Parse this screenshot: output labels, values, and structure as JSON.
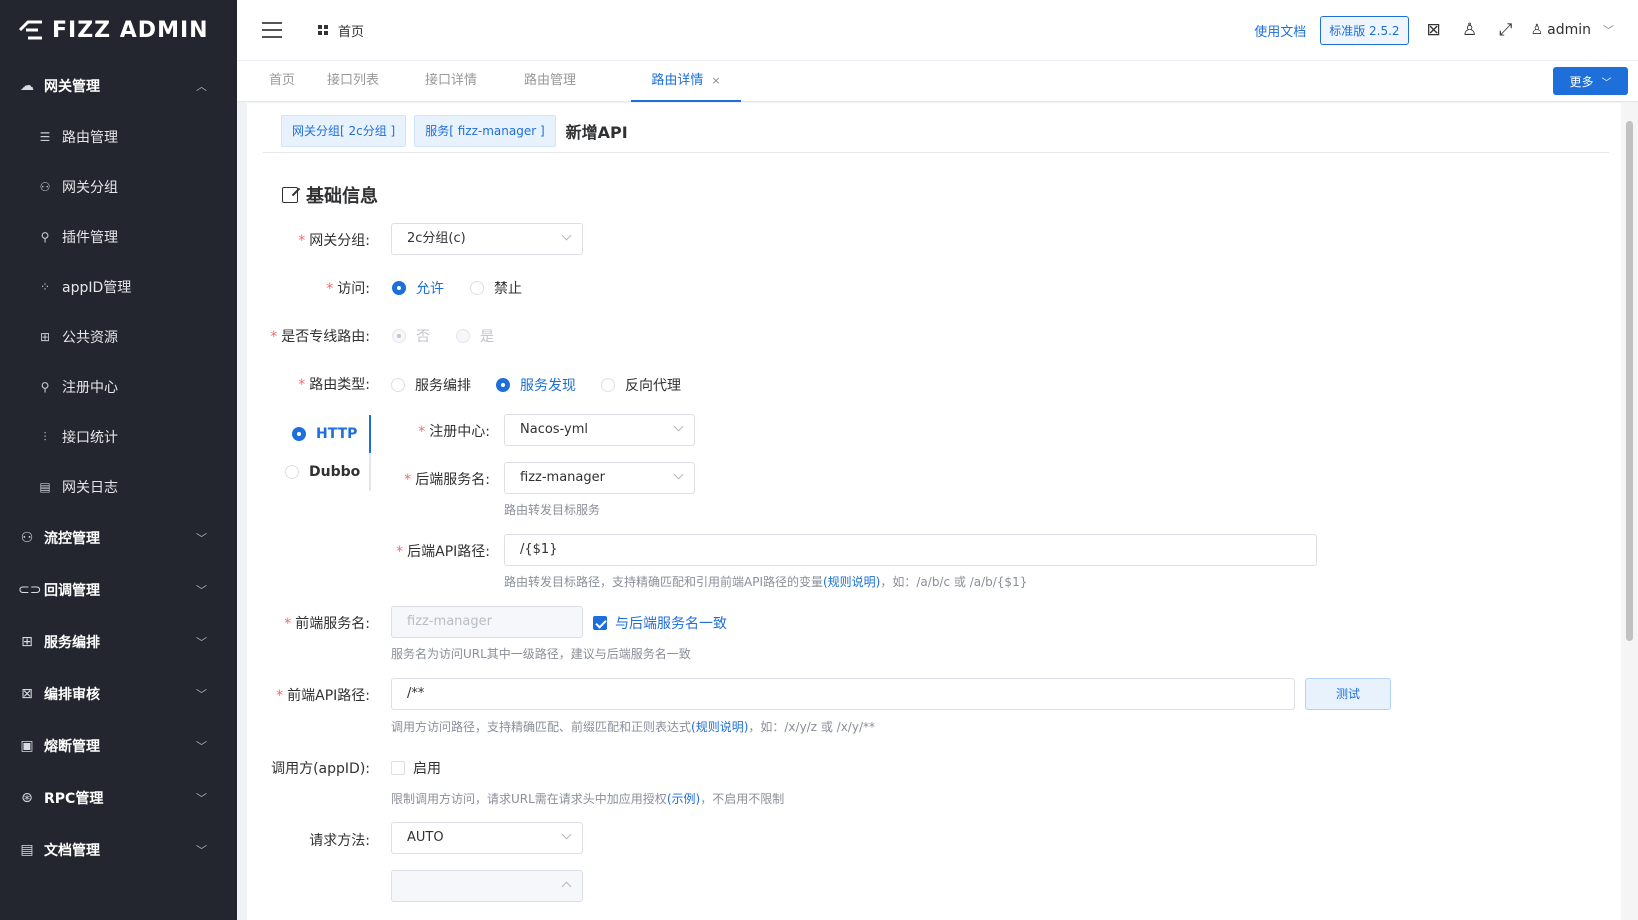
{
  "app": {
    "logo_text": "FIZZ ADMIN"
  },
  "sidebar": {
    "gateway_group": {
      "label": "网关管理"
    },
    "sub_items": [
      {
        "label": "路由管理",
        "icon": "list-icon"
      },
      {
        "label": "网关分组",
        "icon": "hierarchy-icon"
      },
      {
        "label": "插件管理",
        "icon": "pin-icon"
      },
      {
        "label": "appID管理",
        "icon": "grid-icon"
      },
      {
        "label": "公共资源",
        "icon": "table-icon"
      },
      {
        "label": "注册中心",
        "icon": "pin-icon"
      },
      {
        "label": "接口统计",
        "icon": "chart-icon"
      },
      {
        "label": "网关日志",
        "icon": "log-icon"
      }
    ],
    "groups": [
      {
        "label": "流控管理"
      },
      {
        "label": "回调管理"
      },
      {
        "label": "服务编排"
      },
      {
        "label": "编排审核"
      },
      {
        "label": "熔断管理"
      },
      {
        "label": "RPC管理"
      },
      {
        "label": "文档管理"
      }
    ]
  },
  "header": {
    "home": "首页",
    "doc_link": "使用文档",
    "version": "标准版 2.5.2",
    "user": "admin"
  },
  "tabs": [
    {
      "label": "首页"
    },
    {
      "label": "接口列表"
    },
    {
      "label": "接口详情"
    },
    {
      "label": "路由管理"
    },
    {
      "label": "路由详情",
      "close": "×"
    }
  ],
  "more_button": "更多",
  "crumbs": {
    "group_tag": "网关分组[ 2c分组 ]",
    "service_tag": "服务[ fizz-manager ]",
    "title": "新增API"
  },
  "section": {
    "title": "基础信息"
  },
  "form": {
    "gateway_group": {
      "label": "网关分组:",
      "value": "2c分组(c)"
    },
    "access": {
      "label": "访问:",
      "allow": "允许",
      "deny": "禁止"
    },
    "dedicated": {
      "label": "是否专线路由:",
      "no": "否",
      "yes": "是"
    },
    "route_type": {
      "label": "路由类型:",
      "orchestration": "服务编排",
      "discovery": "服务发现",
      "proxy": "反向代理"
    },
    "protocol": {
      "http": "HTTP",
      "dubbo": "Dubbo"
    },
    "registry": {
      "label": "注册中心:",
      "value": "Nacos-yml"
    },
    "backend_service": {
      "label": "后端服务名:",
      "value": "fizz-manager",
      "hint": "路由转发目标服务"
    },
    "backend_path": {
      "label": "后端API路径:",
      "value": "/{$1}",
      "hint_prefix": "路由转发目标路径，支持精确匹配和引用前端API路径的变量",
      "hint_link": "(规则说明)",
      "hint_suffix": "，如：/a/b/c 或 /a/b/{$1}"
    },
    "frontend_service": {
      "label": "前端服务名:",
      "placeholder": "fizz-manager",
      "same_check": "与后端服务名一致",
      "hint": "服务名为访问URL其中一级路径，建议与后端服务名一致"
    },
    "frontend_path": {
      "label": "前端API路径:",
      "value": "/**",
      "test_button": "测试",
      "hint_prefix": "调用方访问路径，支持精确匹配、前缀匹配和正则表达式",
      "hint_link": "(规则说明)",
      "hint_suffix": "，如：/x/y/z 或 /x/y/**"
    },
    "caller": {
      "label": "调用方(appID):",
      "enable": "启用",
      "hint_prefix": "限制调用方访问，请求URL需在请求头中加应用授权",
      "hint_link": "(示例)",
      "hint_suffix": "，不启用不限制"
    },
    "method": {
      "label": "请求方法:",
      "value": "AUTO"
    }
  }
}
